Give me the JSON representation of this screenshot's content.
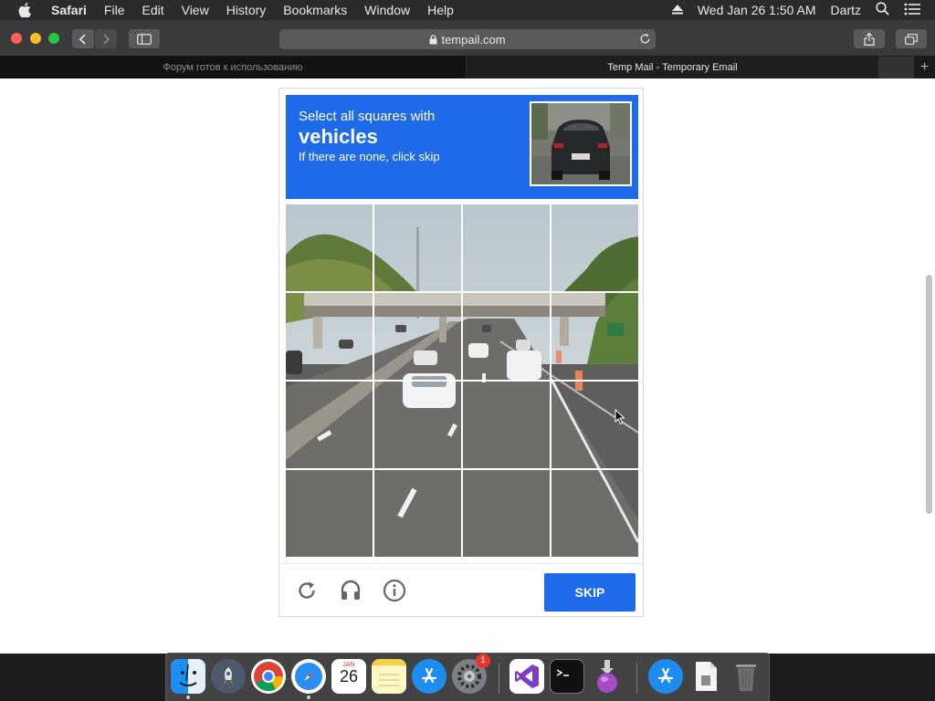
{
  "menubar": {
    "items": [
      "Safari",
      "File",
      "Edit",
      "View",
      "History",
      "Bookmarks",
      "Window",
      "Help"
    ],
    "datetime": "Wed Jan 26  1:50 AM",
    "user": "Dartz"
  },
  "toolbar": {
    "url": "tempail.com"
  },
  "tabs": [
    {
      "title": "Форум готов к использованию",
      "active": false
    },
    {
      "title": "Temp Mail - Temporary Email",
      "active": true
    }
  ],
  "captcha": {
    "prompt_line1": "Select all squares with",
    "prompt_target": "vehicles",
    "prompt_line3": "If there are none, click skip",
    "grid_size": "4x4",
    "skip_label": "SKIP",
    "colors": {
      "accent": "#1f6ae8"
    }
  },
  "dock": {
    "apps": [
      "Finder",
      "Launchpad",
      "Google Chrome",
      "Safari",
      "Calendar",
      "Notes",
      "App Store",
      "System Preferences",
      "Visual Studio",
      "Terminal",
      "Installer",
      "App Store Downloads",
      "Documents",
      "Trash"
    ],
    "calendar_month": "JAN",
    "calendar_day": "26",
    "preferences_badge": "1"
  }
}
